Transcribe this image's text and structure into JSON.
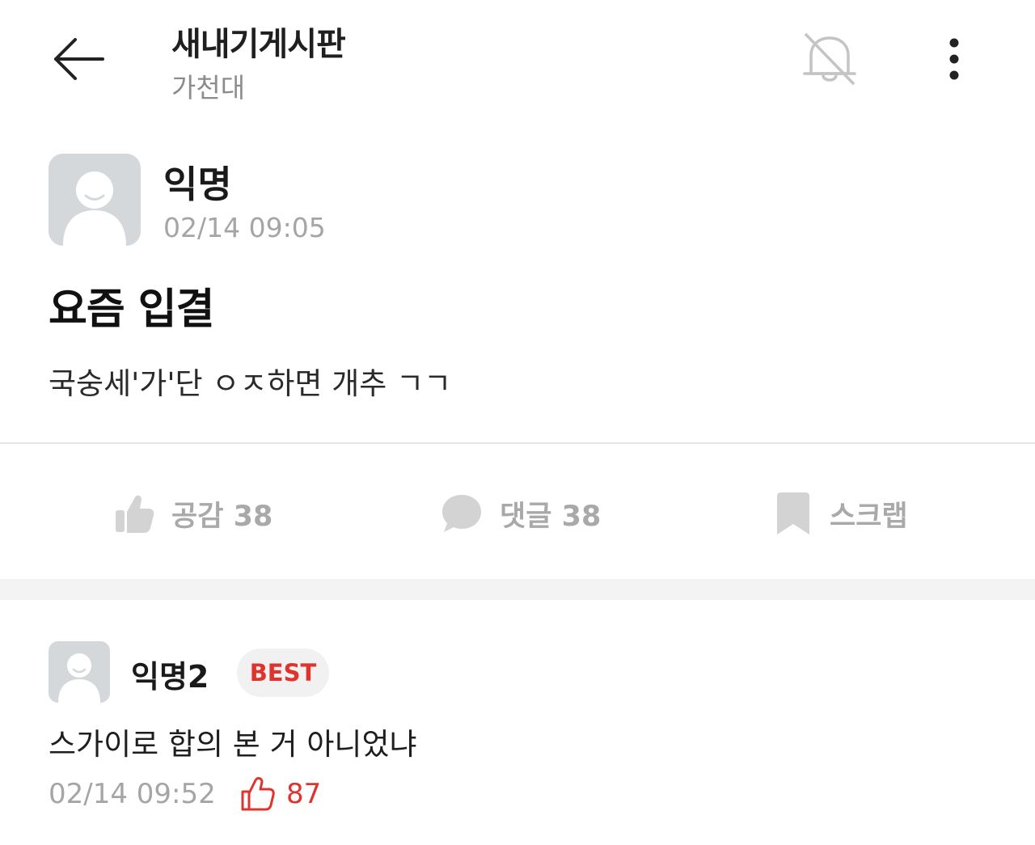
{
  "header": {
    "board_title": "새내기게시판",
    "board_subtitle": "가천대"
  },
  "post": {
    "author": "익명",
    "time": "02/14 09:05",
    "title": "요즘 입결",
    "body": "국숭세'가'단 ㅇㅈ하면 개추 ㄱㄱ"
  },
  "actions": {
    "like_label": "공감 38",
    "comment_label": "댓글 38",
    "scrap_label": "스크랩"
  },
  "comment": {
    "author": "익명2",
    "badge": "BEST",
    "body": "스가이로 합의 본 거 아니었냐",
    "time": "02/14 09:52",
    "likes": "87"
  },
  "colors": {
    "accent_red": "#e0332e",
    "muted_gray": "#a9a9a9",
    "avatar_bg": "#d4d8db"
  },
  "icons": [
    "back-arrow-icon",
    "bell-off-icon",
    "more-vertical-icon",
    "thumbs-up-icon",
    "speech-bubble-icon",
    "bookmark-icon"
  ]
}
